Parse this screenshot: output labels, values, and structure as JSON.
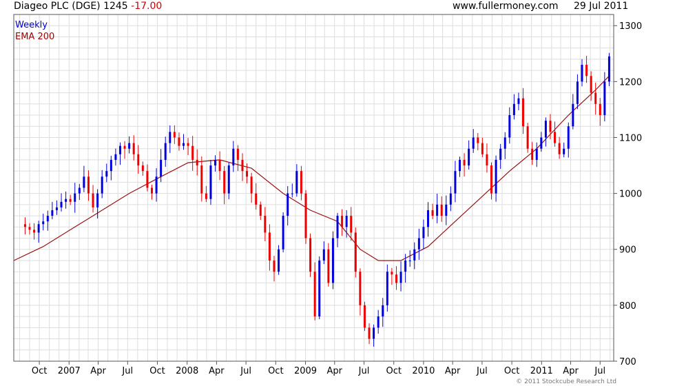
{
  "header": {
    "title": "Diageo PLC (DGE) 1245",
    "change": "-17.00",
    "site": "www.fullermoney.com",
    "date": "29 Jul 2011"
  },
  "legend": {
    "weekly": "Weekly",
    "ema": "EMA 200"
  },
  "credit": "© 2011 Stockcube Research Ltd",
  "colors": {
    "up": "#0000dd",
    "down": "#ee0000",
    "ema": "#9a1010",
    "grid": "#dddddd",
    "frame": "#555555"
  },
  "chart_data": {
    "type": "candlestick",
    "y_ticks": [
      700,
      800,
      900,
      1000,
      1100,
      1200,
      1300
    ],
    "x_ticks": [
      "Oct",
      "2007",
      "Apr",
      "Jul",
      "Oct",
      "2008",
      "Apr",
      "Jul",
      "Oct",
      "2009",
      "Apr",
      "Jul",
      "Oct",
      "2010",
      "Apr",
      "Jul",
      "Oct",
      "2011",
      "Apr",
      "Jul"
    ],
    "ylim": [
      700,
      1320
    ],
    "grid": true,
    "y_axis_side": "right",
    "series": [
      {
        "name": "Weekly",
        "points": [
          [
            "2006-08-04",
            945
          ],
          [
            "2006-08-18",
            940
          ],
          [
            "2006-09-01",
            935
          ],
          [
            "2006-09-15",
            930
          ],
          [
            "2006-09-29",
            945
          ],
          [
            "2006-10-13",
            950
          ],
          [
            "2006-10-27",
            960
          ],
          [
            "2006-11-10",
            970
          ],
          [
            "2006-11-24",
            975
          ],
          [
            "2006-12-08",
            985
          ],
          [
            "2006-12-22",
            990
          ],
          [
            "2007-01-05",
            985
          ],
          [
            "2007-01-19",
            1000
          ],
          [
            "2007-02-02",
            1010
          ],
          [
            "2007-02-16",
            1030
          ],
          [
            "2007-03-02",
            1000
          ],
          [
            "2007-03-16",
            975
          ],
          [
            "2007-03-30",
            1000
          ],
          [
            "2007-04-13",
            1030
          ],
          [
            "2007-04-27",
            1040
          ],
          [
            "2007-05-11",
            1060
          ],
          [
            "2007-05-25",
            1070
          ],
          [
            "2007-06-08",
            1085
          ],
          [
            "2007-06-22",
            1080
          ],
          [
            "2007-07-06",
            1090
          ],
          [
            "2007-07-20",
            1070
          ],
          [
            "2007-08-03",
            1050
          ],
          [
            "2007-08-17",
            1040
          ],
          [
            "2007-08-31",
            1010
          ],
          [
            "2007-09-14",
            1000
          ],
          [
            "2007-09-28",
            1030
          ],
          [
            "2007-10-12",
            1060
          ],
          [
            "2007-10-26",
            1090
          ],
          [
            "2007-11-09",
            1110
          ],
          [
            "2007-11-23",
            1100
          ],
          [
            "2007-12-07",
            1085
          ],
          [
            "2007-12-21",
            1090
          ],
          [
            "2008-01-04",
            1085
          ],
          [
            "2008-01-18",
            1060
          ],
          [
            "2008-02-01",
            1050
          ],
          [
            "2008-02-15",
            1000
          ],
          [
            "2008-02-29",
            990
          ],
          [
            "2008-03-14",
            1050
          ],
          [
            "2008-03-28",
            1060
          ],
          [
            "2008-04-11",
            1040
          ],
          [
            "2008-04-25",
            1000
          ],
          [
            "2008-05-09",
            1050
          ],
          [
            "2008-05-23",
            1080
          ],
          [
            "2008-06-06",
            1060
          ],
          [
            "2008-06-20",
            1040
          ],
          [
            "2008-07-04",
            1030
          ],
          [
            "2008-07-18",
            1000
          ],
          [
            "2008-08-01",
            980
          ],
          [
            "2008-08-15",
            960
          ],
          [
            "2008-08-29",
            930
          ],
          [
            "2008-09-12",
            880
          ],
          [
            "2008-09-26",
            860
          ],
          [
            "2008-10-10",
            900
          ],
          [
            "2008-10-24",
            960
          ],
          [
            "2008-11-07",
            1000
          ],
          [
            "2008-11-21",
            1000
          ],
          [
            "2008-12-05",
            1040
          ],
          [
            "2008-12-19",
            1000
          ],
          [
            "2009-01-02",
            920
          ],
          [
            "2009-01-16",
            860
          ],
          [
            "2009-01-30",
            780
          ],
          [
            "2009-02-13",
            880
          ],
          [
            "2009-02-27",
            900
          ],
          [
            "2009-03-13",
            840
          ],
          [
            "2009-03-27",
            920
          ],
          [
            "2009-04-10",
            960
          ],
          [
            "2009-04-24",
            940
          ],
          [
            "2009-05-08",
            960
          ],
          [
            "2009-05-22",
            930
          ],
          [
            "2009-06-05",
            860
          ],
          [
            "2009-06-19",
            800
          ],
          [
            "2009-07-03",
            760
          ],
          [
            "2009-07-17",
            740
          ],
          [
            "2009-07-31",
            760
          ],
          [
            "2009-08-14",
            780
          ],
          [
            "2009-08-28",
            800
          ],
          [
            "2009-09-11",
            860
          ],
          [
            "2009-09-25",
            855
          ],
          [
            "2009-10-09",
            840
          ],
          [
            "2009-10-23",
            860
          ],
          [
            "2009-11-06",
            880
          ],
          [
            "2009-11-20",
            880
          ],
          [
            "2009-12-04",
            900
          ],
          [
            "2009-12-18",
            920
          ],
          [
            "2010-01-01",
            940
          ],
          [
            "2010-01-15",
            970
          ],
          [
            "2010-01-29",
            960
          ],
          [
            "2010-02-12",
            980
          ],
          [
            "2010-02-26",
            960
          ],
          [
            "2010-03-12",
            980
          ],
          [
            "2010-03-26",
            1000
          ],
          [
            "2010-04-09",
            1040
          ],
          [
            "2010-04-23",
            1060
          ],
          [
            "2010-05-07",
            1050
          ],
          [
            "2010-05-21",
            1080
          ],
          [
            "2010-06-04",
            1100
          ],
          [
            "2010-06-18",
            1090
          ],
          [
            "2010-07-02",
            1070
          ],
          [
            "2010-07-16",
            1050
          ],
          [
            "2010-07-30",
            1000
          ],
          [
            "2010-08-13",
            1060
          ],
          [
            "2010-08-27",
            1080
          ],
          [
            "2010-09-10",
            1100
          ],
          [
            "2010-09-24",
            1140
          ],
          [
            "2010-10-08",
            1160
          ],
          [
            "2010-10-22",
            1170
          ],
          [
            "2010-11-05",
            1120
          ],
          [
            "2010-11-19",
            1080
          ],
          [
            "2010-12-03",
            1060
          ],
          [
            "2010-12-17",
            1080
          ],
          [
            "2010-12-31",
            1100
          ],
          [
            "2011-01-14",
            1130
          ],
          [
            "2011-01-28",
            1110
          ],
          [
            "2011-02-11",
            1090
          ],
          [
            "2011-02-25",
            1070
          ],
          [
            "2011-03-11",
            1080
          ],
          [
            "2011-03-25",
            1120
          ],
          [
            "2011-04-08",
            1160
          ],
          [
            "2011-04-22",
            1200
          ],
          [
            "2011-05-06",
            1230
          ],
          [
            "2011-05-20",
            1210
          ],
          [
            "2011-06-03",
            1180
          ],
          [
            "2011-06-17",
            1160
          ],
          [
            "2011-07-01",
            1140
          ],
          [
            "2011-07-15",
            1200
          ],
          [
            "2011-07-29",
            1245
          ]
        ]
      },
      {
        "name": "EMA 200",
        "points": [
          [
            "2006-07-14",
            880
          ],
          [
            "2006-10-13",
            905
          ],
          [
            "2007-01-19",
            940
          ],
          [
            "2007-04-13",
            970
          ],
          [
            "2007-07-06",
            1000
          ],
          [
            "2007-10-12",
            1030
          ],
          [
            "2008-01-04",
            1055
          ],
          [
            "2008-04-11",
            1060
          ],
          [
            "2008-07-18",
            1045
          ],
          [
            "2008-10-24",
            1000
          ],
          [
            "2009-01-16",
            970
          ],
          [
            "2009-04-10",
            950
          ],
          [
            "2009-06-19",
            900
          ],
          [
            "2009-08-14",
            880
          ],
          [
            "2009-10-23",
            880
          ],
          [
            "2010-01-15",
            905
          ],
          [
            "2010-04-09",
            950
          ],
          [
            "2010-07-02",
            995
          ],
          [
            "2010-09-24",
            1040
          ],
          [
            "2010-12-17",
            1080
          ],
          [
            "2011-03-25",
            1140
          ],
          [
            "2011-06-17",
            1185
          ],
          [
            "2011-07-29",
            1210
          ]
        ]
      }
    ]
  }
}
